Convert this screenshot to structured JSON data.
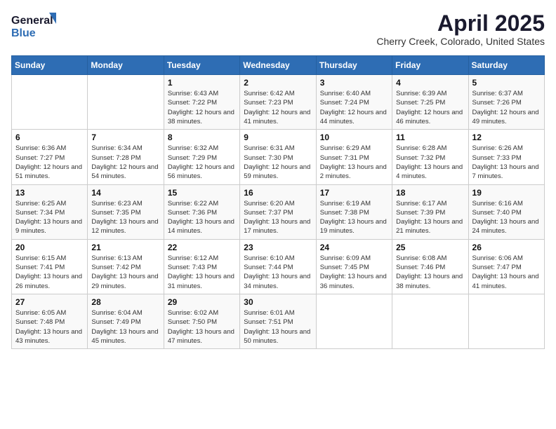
{
  "header": {
    "logo_general": "General",
    "logo_blue": "Blue",
    "month": "April 2025",
    "location": "Cherry Creek, Colorado, United States"
  },
  "weekdays": [
    "Sunday",
    "Monday",
    "Tuesday",
    "Wednesday",
    "Thursday",
    "Friday",
    "Saturday"
  ],
  "weeks": [
    [
      {
        "day": "",
        "info": ""
      },
      {
        "day": "",
        "info": ""
      },
      {
        "day": "1",
        "info": "Sunrise: 6:43 AM\nSunset: 7:22 PM\nDaylight: 12 hours and 38 minutes."
      },
      {
        "day": "2",
        "info": "Sunrise: 6:42 AM\nSunset: 7:23 PM\nDaylight: 12 hours and 41 minutes."
      },
      {
        "day": "3",
        "info": "Sunrise: 6:40 AM\nSunset: 7:24 PM\nDaylight: 12 hours and 44 minutes."
      },
      {
        "day": "4",
        "info": "Sunrise: 6:39 AM\nSunset: 7:25 PM\nDaylight: 12 hours and 46 minutes."
      },
      {
        "day": "5",
        "info": "Sunrise: 6:37 AM\nSunset: 7:26 PM\nDaylight: 12 hours and 49 minutes."
      }
    ],
    [
      {
        "day": "6",
        "info": "Sunrise: 6:36 AM\nSunset: 7:27 PM\nDaylight: 12 hours and 51 minutes."
      },
      {
        "day": "7",
        "info": "Sunrise: 6:34 AM\nSunset: 7:28 PM\nDaylight: 12 hours and 54 minutes."
      },
      {
        "day": "8",
        "info": "Sunrise: 6:32 AM\nSunset: 7:29 PM\nDaylight: 12 hours and 56 minutes."
      },
      {
        "day": "9",
        "info": "Sunrise: 6:31 AM\nSunset: 7:30 PM\nDaylight: 12 hours and 59 minutes."
      },
      {
        "day": "10",
        "info": "Sunrise: 6:29 AM\nSunset: 7:31 PM\nDaylight: 13 hours and 2 minutes."
      },
      {
        "day": "11",
        "info": "Sunrise: 6:28 AM\nSunset: 7:32 PM\nDaylight: 13 hours and 4 minutes."
      },
      {
        "day": "12",
        "info": "Sunrise: 6:26 AM\nSunset: 7:33 PM\nDaylight: 13 hours and 7 minutes."
      }
    ],
    [
      {
        "day": "13",
        "info": "Sunrise: 6:25 AM\nSunset: 7:34 PM\nDaylight: 13 hours and 9 minutes."
      },
      {
        "day": "14",
        "info": "Sunrise: 6:23 AM\nSunset: 7:35 PM\nDaylight: 13 hours and 12 minutes."
      },
      {
        "day": "15",
        "info": "Sunrise: 6:22 AM\nSunset: 7:36 PM\nDaylight: 13 hours and 14 minutes."
      },
      {
        "day": "16",
        "info": "Sunrise: 6:20 AM\nSunset: 7:37 PM\nDaylight: 13 hours and 17 minutes."
      },
      {
        "day": "17",
        "info": "Sunrise: 6:19 AM\nSunset: 7:38 PM\nDaylight: 13 hours and 19 minutes."
      },
      {
        "day": "18",
        "info": "Sunrise: 6:17 AM\nSunset: 7:39 PM\nDaylight: 13 hours and 21 minutes."
      },
      {
        "day": "19",
        "info": "Sunrise: 6:16 AM\nSunset: 7:40 PM\nDaylight: 13 hours and 24 minutes."
      }
    ],
    [
      {
        "day": "20",
        "info": "Sunrise: 6:15 AM\nSunset: 7:41 PM\nDaylight: 13 hours and 26 minutes."
      },
      {
        "day": "21",
        "info": "Sunrise: 6:13 AM\nSunset: 7:42 PM\nDaylight: 13 hours and 29 minutes."
      },
      {
        "day": "22",
        "info": "Sunrise: 6:12 AM\nSunset: 7:43 PM\nDaylight: 13 hours and 31 minutes."
      },
      {
        "day": "23",
        "info": "Sunrise: 6:10 AM\nSunset: 7:44 PM\nDaylight: 13 hours and 34 minutes."
      },
      {
        "day": "24",
        "info": "Sunrise: 6:09 AM\nSunset: 7:45 PM\nDaylight: 13 hours and 36 minutes."
      },
      {
        "day": "25",
        "info": "Sunrise: 6:08 AM\nSunset: 7:46 PM\nDaylight: 13 hours and 38 minutes."
      },
      {
        "day": "26",
        "info": "Sunrise: 6:06 AM\nSunset: 7:47 PM\nDaylight: 13 hours and 41 minutes."
      }
    ],
    [
      {
        "day": "27",
        "info": "Sunrise: 6:05 AM\nSunset: 7:48 PM\nDaylight: 13 hours and 43 minutes."
      },
      {
        "day": "28",
        "info": "Sunrise: 6:04 AM\nSunset: 7:49 PM\nDaylight: 13 hours and 45 minutes."
      },
      {
        "day": "29",
        "info": "Sunrise: 6:02 AM\nSunset: 7:50 PM\nDaylight: 13 hours and 47 minutes."
      },
      {
        "day": "30",
        "info": "Sunrise: 6:01 AM\nSunset: 7:51 PM\nDaylight: 13 hours and 50 minutes."
      },
      {
        "day": "",
        "info": ""
      },
      {
        "day": "",
        "info": ""
      },
      {
        "day": "",
        "info": ""
      }
    ]
  ]
}
